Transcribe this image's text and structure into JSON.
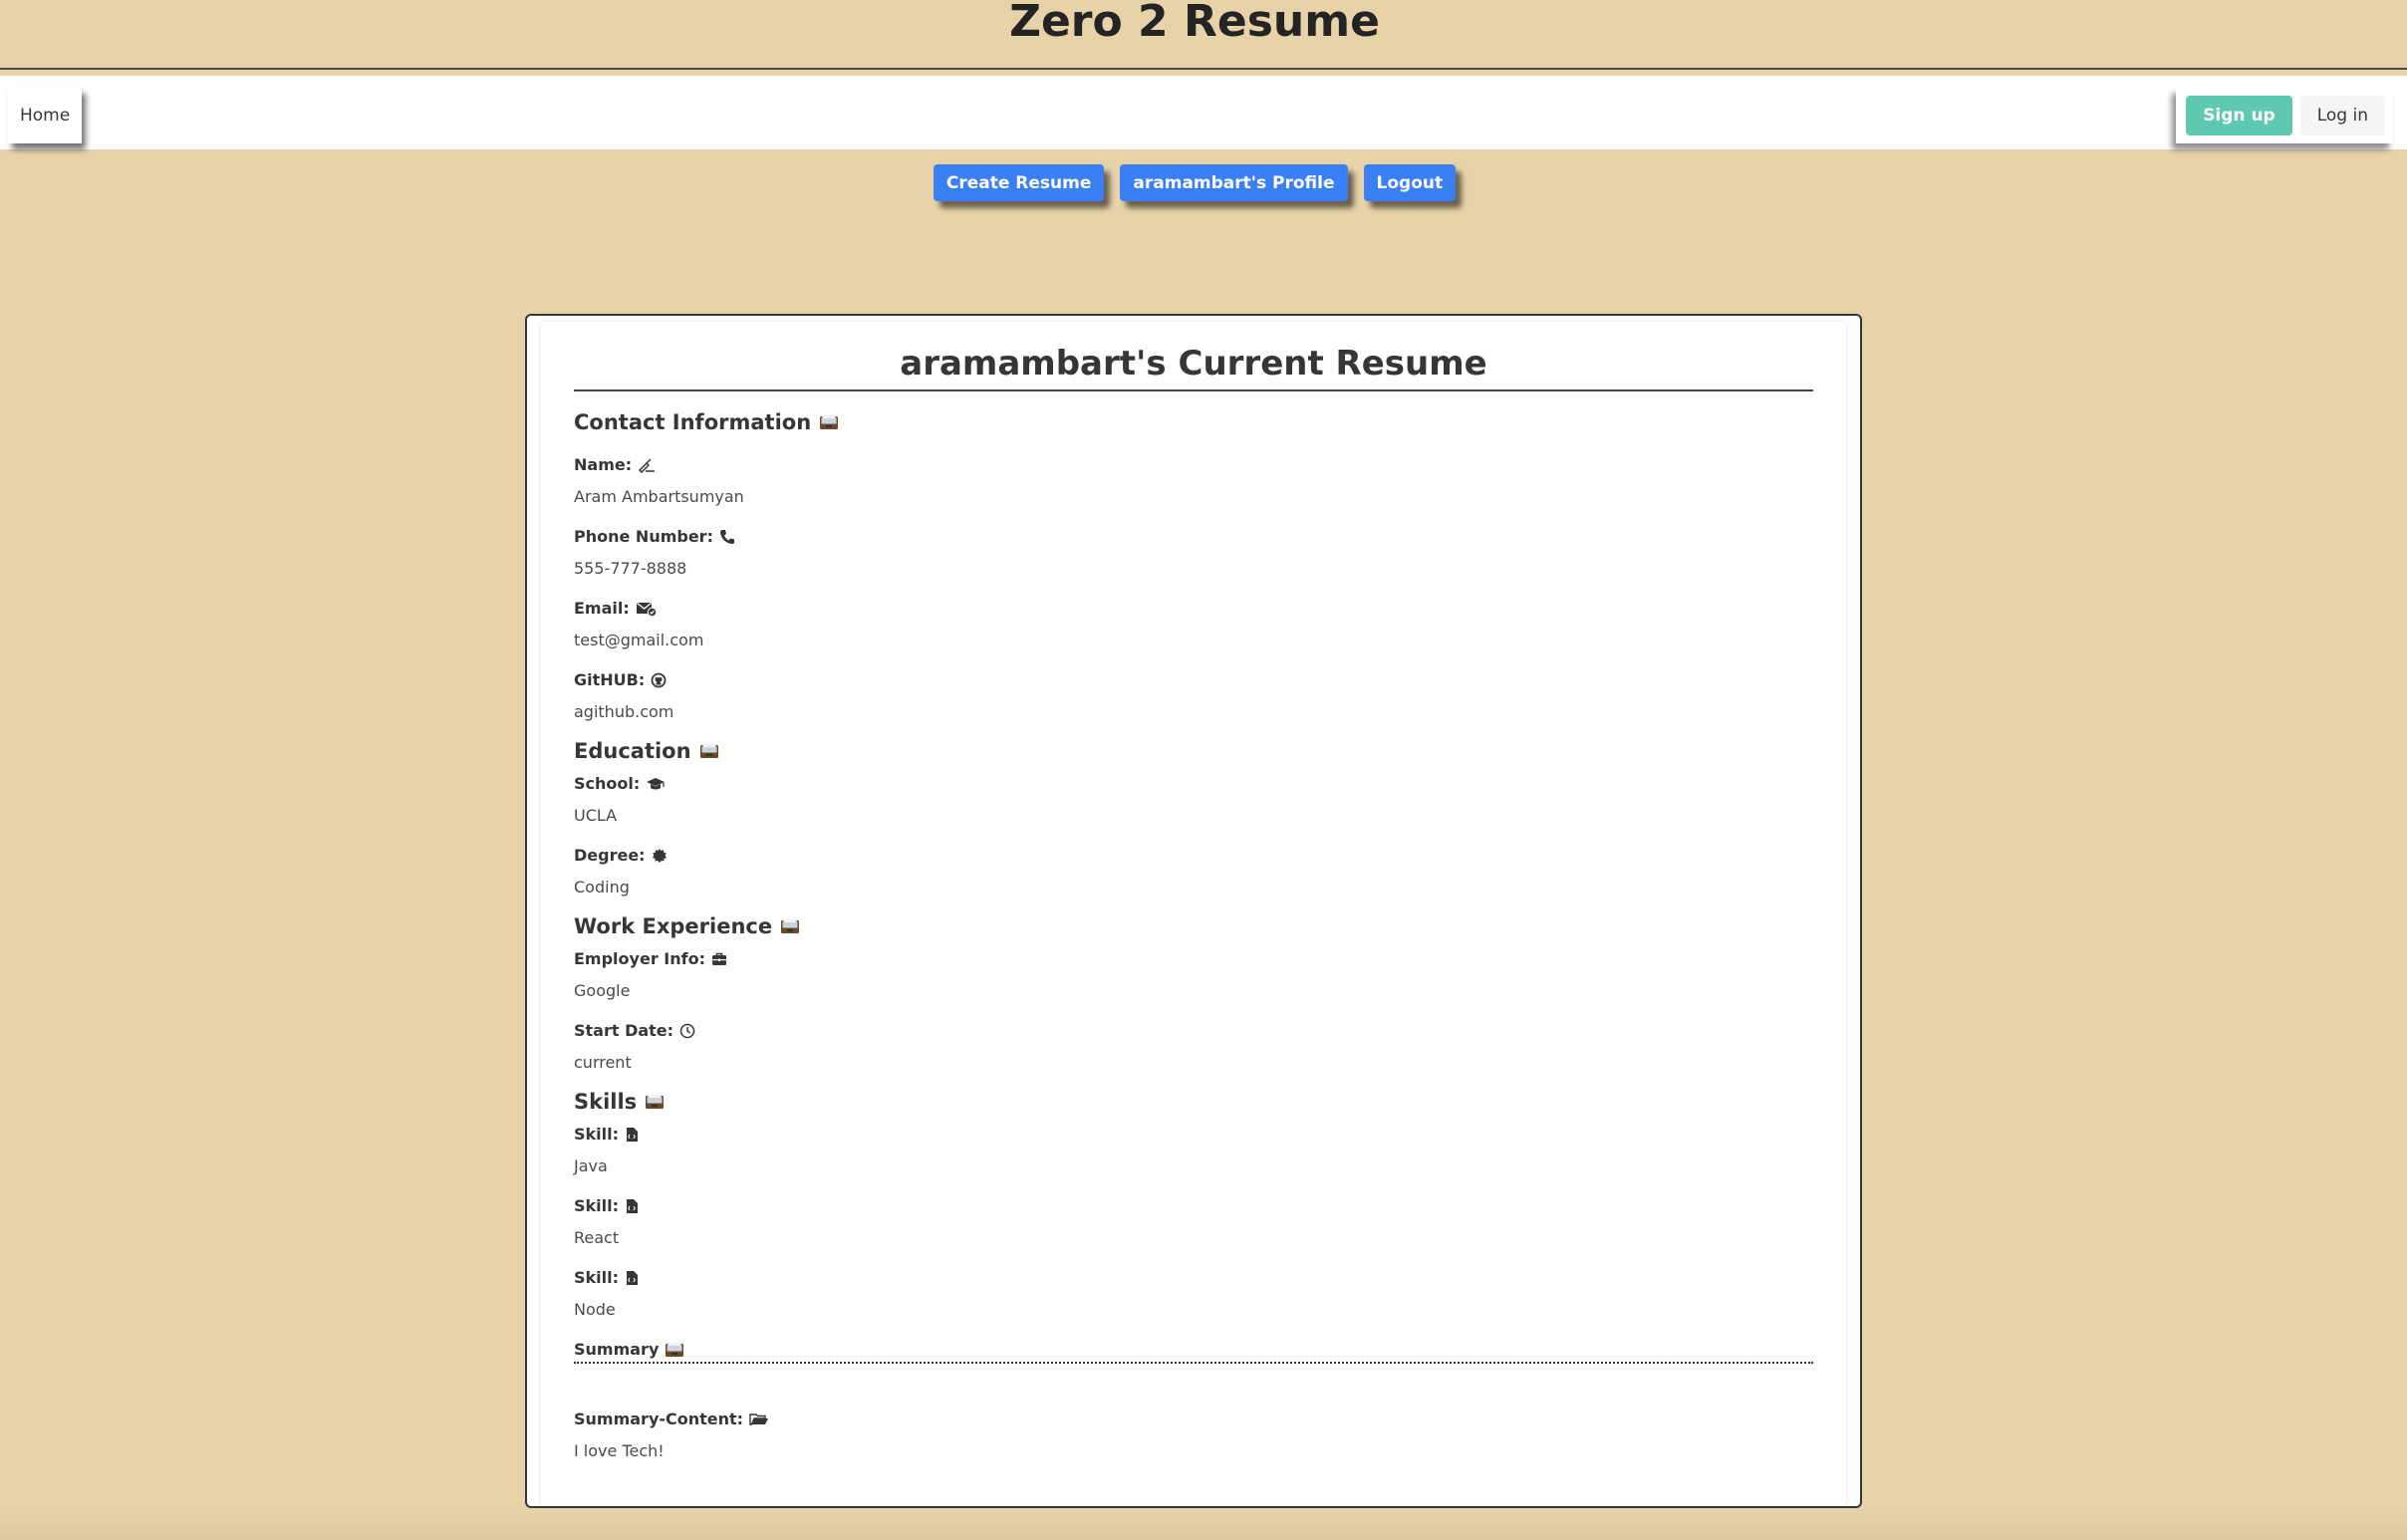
{
  "site": {
    "title": "Zero 2 Resume"
  },
  "navbar": {
    "home_label": "Home",
    "signup_label": "Sign up",
    "login_label": "Log in"
  },
  "actions": {
    "create_resume_label": "Create Resume",
    "profile_label": "aramambart's Profile",
    "logout_label": "Logout"
  },
  "resume": {
    "title": "aramambart's Current Resume",
    "contact": {
      "heading": "Contact Information",
      "heading_icon": "card-file-box-icon",
      "name_label": "Name:",
      "name_icon": "writing-hand-icon",
      "name_value": "Aram Ambartsumyan",
      "phone_label": "Phone Number:",
      "phone_icon": "phone-icon",
      "phone_value": "555-777-8888",
      "email_label": "Email:",
      "email_icon": "envelope-check-icon",
      "email_value": "test@gmail.com",
      "github_label": "GitHUB:",
      "github_icon": "github-icon",
      "github_value": "agithub.com"
    },
    "education": {
      "heading": "Education",
      "heading_icon": "card-file-box-icon",
      "school_label": "School:",
      "school_icon": "graduation-cap-icon",
      "school_value": "UCLA",
      "degree_label": "Degree:",
      "degree_icon": "badge-icon",
      "degree_value": "Coding"
    },
    "work": {
      "heading": "Work Experience",
      "heading_icon": "card-file-box-icon",
      "employer_label": "Employer Info:",
      "employer_icon": "briefcase-icon",
      "employer_value": "Google",
      "start_label": "Start Date:",
      "start_icon": "clock-icon",
      "start_value": "current"
    },
    "skills": {
      "heading": "Skills",
      "heading_icon": "card-file-box-icon",
      "items": [
        {
          "label": "Skill:",
          "icon": "file-code-icon",
          "value": "Java"
        },
        {
          "label": "Skill:",
          "icon": "file-code-icon",
          "value": "React"
        },
        {
          "label": "Skill:",
          "icon": "file-code-icon",
          "value": "Node"
        }
      ]
    },
    "summary": {
      "heading": "Summary",
      "heading_icon": "card-file-box-icon",
      "content_label": "Summary-Content:",
      "content_icon": "open-folder-icon",
      "content_value": "I love Tech!"
    }
  },
  "colors": {
    "background": "#e8d3a9",
    "primary_button": "#3b7ff5",
    "signup_button": "#5ec9b0",
    "text": "#363636"
  }
}
